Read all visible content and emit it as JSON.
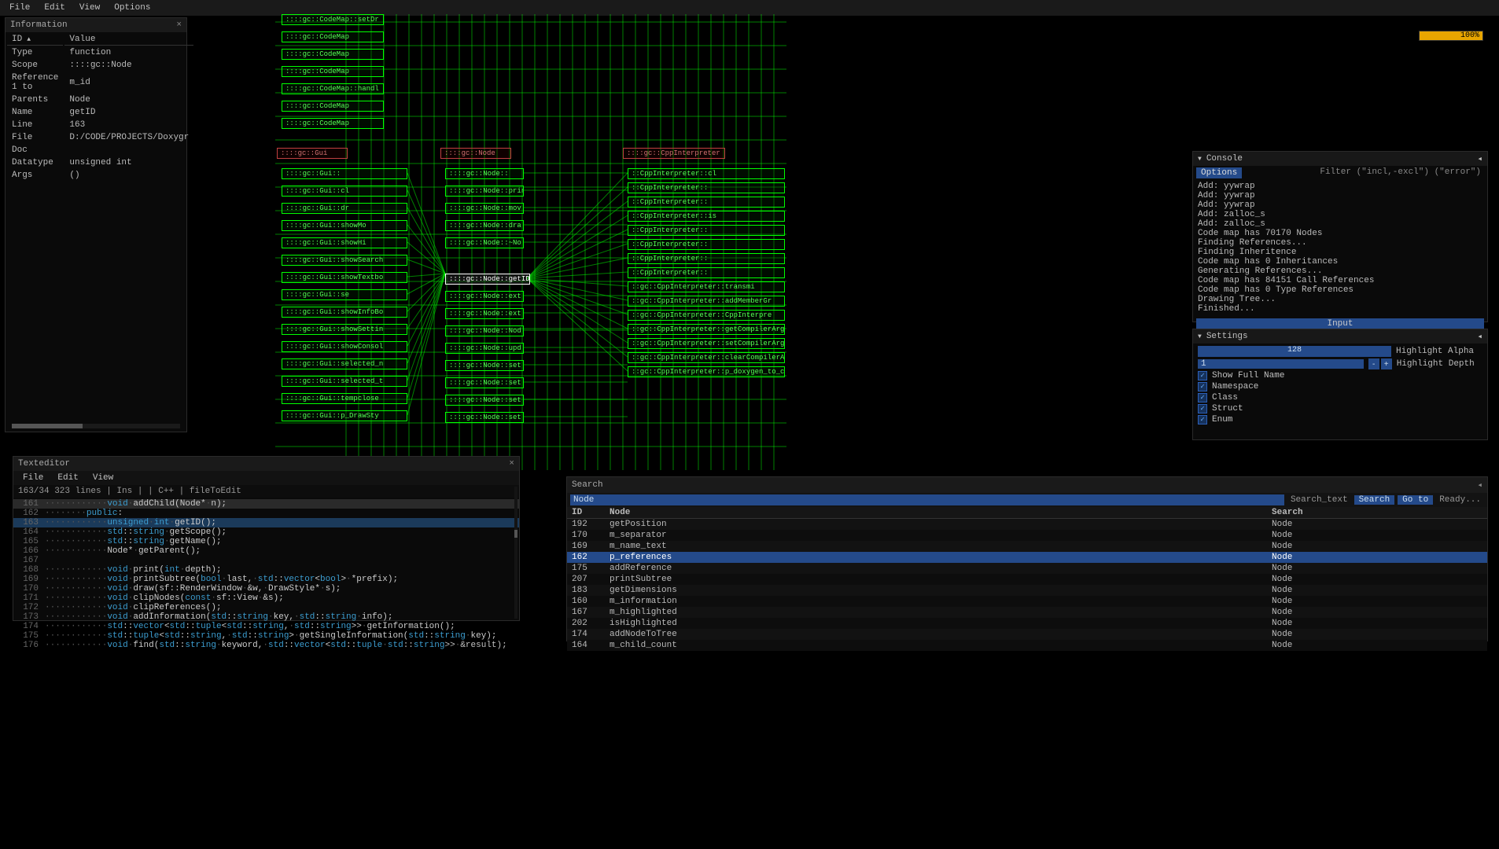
{
  "menubar": [
    "File",
    "Edit",
    "View",
    "Options"
  ],
  "info": {
    "title": "Information",
    "headers": [
      "ID",
      "Value"
    ],
    "rows": [
      [
        "Type",
        "function"
      ],
      [
        "Scope",
        "::::gc::Node"
      ],
      [
        "Reference 1 to",
        "m_id"
      ],
      [
        "Parents",
        "Node"
      ],
      [
        "Name",
        "getID"
      ],
      [
        "Line",
        "163"
      ],
      [
        "File",
        "D:/CODE/PROJECTS/Doxygr"
      ],
      [
        "Doc",
        ""
      ],
      [
        "Datatype",
        "unsigned int"
      ],
      [
        "Args",
        "()"
      ]
    ]
  },
  "progress": "100%",
  "console": {
    "title": "Console",
    "opt": "Options",
    "filter": "Filter (\"incl,-excl\") (\"error\")",
    "log": [
      "Add: yywrap",
      "Add: yywrap",
      "Add: yywrap",
      "Add: zalloc_s",
      "Add: zalloc_s",
      "Code map has 70170 Nodes",
      "Finding References...",
      "Finding Inheritence",
      "Code map has 0 Inheritances",
      "Generating References...",
      "Code map has 84151 Call References",
      "Code map has 0 Type References",
      "Drawing Tree...",
      "Finished..."
    ],
    "input_placeholder": "Input"
  },
  "settings": {
    "title": "Settings",
    "slider_val": "128",
    "slider_label": "Highlight Alpha",
    "depth_val": "1",
    "depth_label": "Highlight Depth",
    "checks": [
      {
        "label": "Show Full Name",
        "checked": true
      },
      {
        "label": "Namespace",
        "checked": true
      },
      {
        "label": "Class",
        "checked": true
      },
      {
        "label": "Struct",
        "checked": true
      },
      {
        "label": "Enum",
        "checked": true
      }
    ]
  },
  "texteditor": {
    "title": "Texteditor",
    "menubar": [
      "File",
      "Edit",
      "View"
    ],
    "status": "   163/34    323 lines  | Ins |    | C++ | fileToEdit",
    "lines": [
      {
        "n": "161",
        "hl": "pale",
        "raw": "············void·addChild(Node*·n);"
      },
      {
        "n": "162",
        "hl": "",
        "raw": "········public:"
      },
      {
        "n": "163",
        "hl": "blue",
        "raw": "············unsigned·int·getID();"
      },
      {
        "n": "164",
        "hl": "",
        "raw": "············std::string·getScope();"
      },
      {
        "n": "165",
        "hl": "",
        "raw": "············std::string·getName();"
      },
      {
        "n": "166",
        "hl": "",
        "raw": "············Node*·getParent();"
      },
      {
        "n": "167",
        "hl": "",
        "raw": ""
      },
      {
        "n": "168",
        "hl": "",
        "raw": "············void·print(int·depth);"
      },
      {
        "n": "169",
        "hl": "",
        "raw": "············void·printSubtree(bool·last,·std::vector<bool>·*prefix);"
      },
      {
        "n": "170",
        "hl": "",
        "raw": "············void·draw(sf::RenderWindow·&w,·DrawStyle*·s);"
      },
      {
        "n": "171",
        "hl": "",
        "raw": "············void·clipNodes(const·sf::View·&s);"
      },
      {
        "n": "172",
        "hl": "",
        "raw": "············void·clipReferences();"
      },
      {
        "n": "173",
        "hl": "",
        "raw": "············void·addInformation(std::string·key,·std::string·info);"
      },
      {
        "n": "174",
        "hl": "",
        "raw": "············std::vector<std::tuple<std::string,·std::string>>·getInformation();"
      },
      {
        "n": "175",
        "hl": "",
        "raw": "············std::tuple<std::string,·std::string>·getSingleInformation(std::string·key);"
      },
      {
        "n": "176",
        "hl": "",
        "raw": "············void·find(std::string·keyword,·std::vector<std::tuple<Node*,·std::string>>·&result);"
      }
    ]
  },
  "search": {
    "title": "Search",
    "input_value": "Node",
    "text_label": "Search_text",
    "search_btn": "Search",
    "goto_btn": "Go to",
    "ready": "Ready...",
    "headers": [
      "ID",
      "Node",
      "Search"
    ],
    "rows": [
      {
        "id": "192",
        "node": "getPosition",
        "search": "Node",
        "hl": false
      },
      {
        "id": "170",
        "node": "m_separator",
        "search": "Node",
        "hl": false
      },
      {
        "id": "169",
        "node": "m_name_text",
        "search": "Node",
        "hl": false
      },
      {
        "id": "162",
        "node": "p_references",
        "search": "Node",
        "hl": true
      },
      {
        "id": "175",
        "node": "addReference",
        "search": "Node",
        "hl": false
      },
      {
        "id": "207",
        "node": "printSubtree",
        "search": "Node",
        "hl": false
      },
      {
        "id": "183",
        "node": "getDimensions",
        "search": "Node",
        "hl": false
      },
      {
        "id": "160",
        "node": "m_information",
        "search": "Node",
        "hl": false
      },
      {
        "id": "167",
        "node": "m_highlighted",
        "search": "Node",
        "hl": false
      },
      {
        "id": "202",
        "node": "isHighlighted",
        "search": "Node",
        "hl": false
      },
      {
        "id": "174",
        "node": "addNodeToTree",
        "search": "Node",
        "hl": false
      },
      {
        "id": "164",
        "node": "m_child_count",
        "search": "Node",
        "hl": false
      }
    ]
  },
  "graph": {
    "col1": [
      "::::gc::CodeMap::setDr",
      "::::gc::CodeMap",
      "::::gc::CodeMap",
      "::::gc::CodeMap",
      "::::gc::CodeMap::handl",
      "::::gc::CodeMap",
      "::::gc::CodeMap"
    ],
    "col1_red": "::::gc::Gui",
    "col1_lower": [
      "::::gc::Gui::",
      "::::gc::Gui::cl",
      "::::gc::Gui::dr",
      "::::gc::Gui::showMo",
      "::::gc::Gui::showHi",
      "::::gc::Gui::showSearch",
      "::::gc::Gui::showTextbo",
      "::::gc::Gui::se",
      "::::gc::Gui::showInfoBo",
      "::::gc::Gui::showSettin",
      "::::gc::Gui::showConsol",
      "::::gc::Gui::selected_n",
      "::::gc::Gui::selected_t",
      "::::gc::Gui::tempclose",
      "::::gc::Gui::p_DrawSty"
    ],
    "col2_red": "::::gc::Node",
    "col2": [
      "::::gc::Node::",
      "::::gc::Node::prin",
      "::::gc::Node::mov",
      "::::gc::Node::dra",
      "::::gc::Node::~No"
    ],
    "col2_hl": "::::gc::Node::getID",
    "col2_lower": [
      "::::gc::Node::ext",
      "::::gc::Node::ext",
      "::::gc::Node::Nod",
      "::::gc::Node::upd",
      "::::gc::Node::set",
      "::::gc::Node::set",
      "::::gc::Node::set",
      "::::gc::Node::set"
    ],
    "col3_red": "::::gc::CppInterpreter",
    "col3": [
      "::CppInterpreter::cl",
      "::CppInterpreter::",
      "::CppInterpreter::",
      "::CppInterpreter::is",
      "::CppInterpreter::",
      "::CppInterpreter::",
      "::CppInterpreter::",
      "::CppInterpreter::",
      "::gc::CppInterpreter::transmi",
      "::gc::CppInterpreter::addMemberGr",
      "::gc::CppInterpreter::CppInterpre",
      "::gc::CppInterpreter::getCompilerArguments",
      "::gc::CppInterpreter::setCompilerArguments",
      "::gc::CppInterpreter::clearCompilerArguments",
      "::gc::CppInterpreter::p_doxygen_to_code_tree"
    ]
  }
}
